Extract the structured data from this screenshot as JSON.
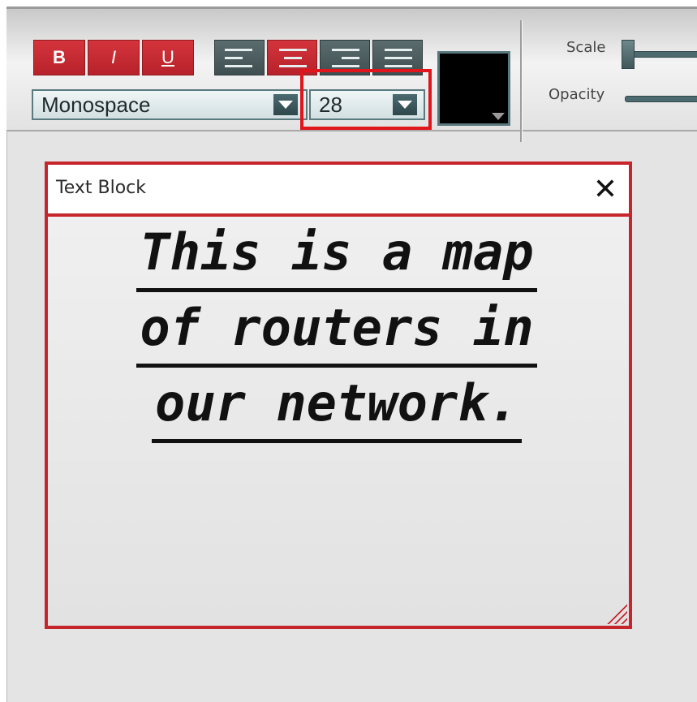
{
  "toolbar": {
    "bold_label": "B",
    "italic_label": "I",
    "underline_label": "U",
    "align_buttons": [
      "align-left",
      "align-center",
      "align-right",
      "align-justify"
    ],
    "active_alignment": "align-center",
    "font_family": "Monospace",
    "font_size": "28",
    "text_color": "#000000",
    "scale_label": "Scale",
    "opacity_label": "Opacity"
  },
  "text_block": {
    "title": "Text Block",
    "close_label": "✕",
    "lines": [
      "This is a map",
      "of routers in",
      "our network."
    ]
  },
  "colors": {
    "accent": "#c7252c",
    "control": "#4c6a6f"
  }
}
